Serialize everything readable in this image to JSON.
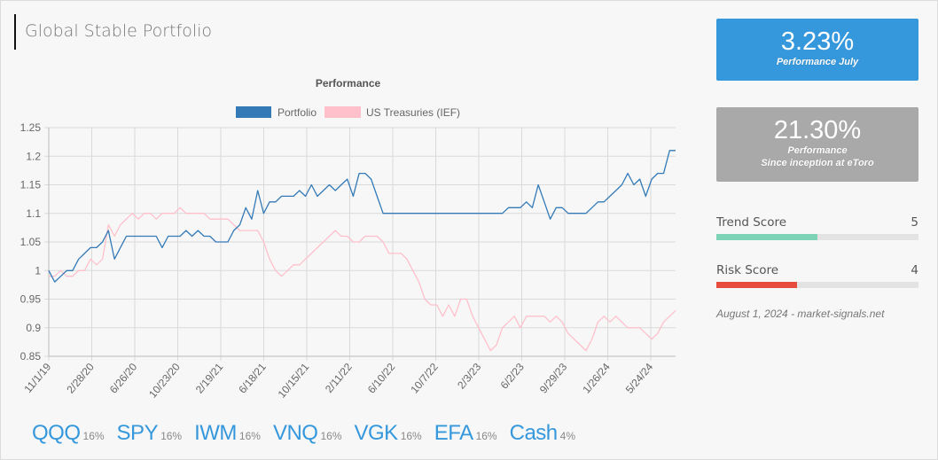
{
  "page": {
    "title": "Global Stable Portfolio"
  },
  "cards": {
    "monthly": {
      "value": "3.23%",
      "label": "Performance July",
      "color": "#3598dc"
    },
    "inception": {
      "value": "21.30%",
      "label_line1": "Performance",
      "label_line2": "Since inception at eToro",
      "color": "#a9a9a9"
    }
  },
  "scores": {
    "trend": {
      "label": "Trend Score",
      "value": "5",
      "fraction": 0.5,
      "color": "#7dd3b5"
    },
    "risk": {
      "label": "Risk Score",
      "value": "4",
      "fraction": 0.4,
      "color": "#e74c3c"
    }
  },
  "stamp": "August 1, 2024 - market-signals.net",
  "holdings": [
    {
      "symbol": "QQQ",
      "weight": "16%"
    },
    {
      "symbol": "SPY",
      "weight": "16%"
    },
    {
      "symbol": "IWM",
      "weight": "16%"
    },
    {
      "symbol": "VNQ",
      "weight": "16%"
    },
    {
      "symbol": "VGK",
      "weight": "16%"
    },
    {
      "symbol": "EFA",
      "weight": "16%"
    },
    {
      "symbol": "Cash",
      "weight": "4%"
    }
  ],
  "chart_data": {
    "type": "line",
    "title": "Performance",
    "xlabel": "",
    "ylabel": "",
    "ylim": [
      0.85,
      1.25
    ],
    "yticks": [
      "1.25",
      "1.2",
      "1.15",
      "1.1",
      "1.05",
      "1",
      "0.95",
      "0.9",
      "0.85"
    ],
    "xticks": [
      "11/1/19",
      "2/28/20",
      "6/26/20",
      "10/23/20",
      "2/19/21",
      "6/18/21",
      "10/15/21",
      "2/11/22",
      "6/10/22",
      "10/7/22",
      "2/3/23",
      "6/2/23",
      "9/29/23",
      "1/26/24",
      "5/24/24"
    ],
    "grid": true,
    "legend_position": "top-center",
    "x_points_per_tick": 4,
    "series": [
      {
        "name": "Portfolio",
        "color": "#337ab7",
        "values": [
          1.0,
          0.98,
          0.99,
          1.0,
          1.0,
          1.02,
          1.03,
          1.04,
          1.04,
          1.05,
          1.07,
          1.02,
          1.04,
          1.06,
          1.06,
          1.06,
          1.06,
          1.06,
          1.06,
          1.04,
          1.06,
          1.06,
          1.06,
          1.07,
          1.06,
          1.07,
          1.06,
          1.06,
          1.05,
          1.05,
          1.05,
          1.07,
          1.08,
          1.11,
          1.09,
          1.14,
          1.1,
          1.12,
          1.12,
          1.13,
          1.13,
          1.13,
          1.14,
          1.13,
          1.15,
          1.13,
          1.14,
          1.15,
          1.14,
          1.15,
          1.16,
          1.13,
          1.17,
          1.17,
          1.16,
          1.13,
          1.1,
          1.1,
          1.1,
          1.1,
          1.1,
          1.1,
          1.1,
          1.1,
          1.1,
          1.1,
          1.1,
          1.1,
          1.1,
          1.1,
          1.1,
          1.1,
          1.1,
          1.1,
          1.1,
          1.1,
          1.1,
          1.11,
          1.11,
          1.11,
          1.12,
          1.11,
          1.15,
          1.12,
          1.09,
          1.11,
          1.11,
          1.1,
          1.1,
          1.1,
          1.1,
          1.11,
          1.12,
          1.12,
          1.13,
          1.14,
          1.15,
          1.17,
          1.15,
          1.16,
          1.13,
          1.16,
          1.17,
          1.17,
          1.21,
          1.21
        ]
      },
      {
        "name": "US Treasuries (IEF)",
        "color": "#ffc0cb",
        "values": [
          0.99,
          0.99,
          1.0,
          0.99,
          0.99,
          1.0,
          1.0,
          1.02,
          1.01,
          1.02,
          1.08,
          1.06,
          1.08,
          1.09,
          1.1,
          1.09,
          1.1,
          1.1,
          1.09,
          1.1,
          1.1,
          1.1,
          1.11,
          1.1,
          1.1,
          1.1,
          1.1,
          1.09,
          1.09,
          1.09,
          1.09,
          1.08,
          1.07,
          1.07,
          1.07,
          1.07,
          1.05,
          1.02,
          1.0,
          0.99,
          1.0,
          1.01,
          1.01,
          1.02,
          1.03,
          1.04,
          1.05,
          1.06,
          1.07,
          1.06,
          1.06,
          1.05,
          1.05,
          1.06,
          1.06,
          1.06,
          1.05,
          1.03,
          1.03,
          1.03,
          1.02,
          1.0,
          0.98,
          0.95,
          0.94,
          0.94,
          0.92,
          0.94,
          0.92,
          0.95,
          0.95,
          0.92,
          0.9,
          0.88,
          0.86,
          0.87,
          0.9,
          0.91,
          0.92,
          0.9,
          0.92,
          0.92,
          0.92,
          0.92,
          0.91,
          0.92,
          0.91,
          0.89,
          0.88,
          0.87,
          0.86,
          0.88,
          0.91,
          0.92,
          0.91,
          0.92,
          0.91,
          0.9,
          0.9,
          0.9,
          0.89,
          0.88,
          0.89,
          0.91,
          0.92,
          0.93
        ]
      }
    ]
  }
}
